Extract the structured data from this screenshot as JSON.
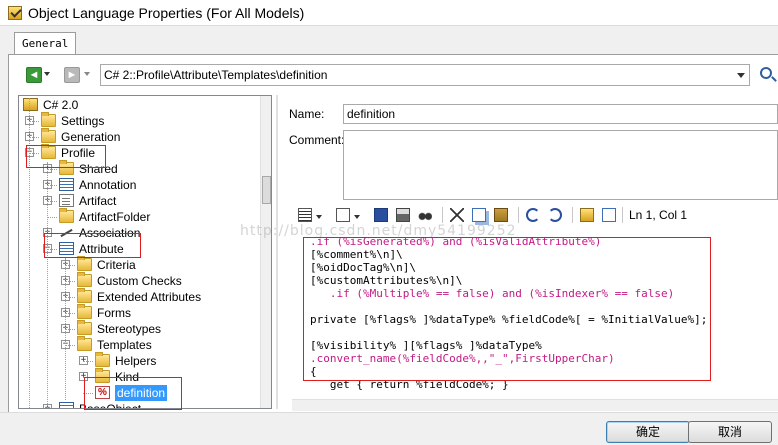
{
  "window": {
    "title": "Object Language Properties (For All Models)"
  },
  "tabs": [
    {
      "label": "General"
    }
  ],
  "navigation": {
    "back_glyph": "◄",
    "forward_glyph": "►",
    "path": "C# 2::Profile\\Attribute\\Templates\\definition",
    "back_icon": "arrow-left-icon",
    "forward_icon": "arrow-right-icon",
    "find_icon": "search-icon"
  },
  "tree": {
    "items": [
      {
        "label": "C# 2.0",
        "icon": "model-icon"
      },
      {
        "label": "Settings",
        "icon": "folder-icon"
      },
      {
        "label": "Generation",
        "icon": "folder-icon"
      },
      {
        "label": "Profile",
        "icon": "folder-open-icon"
      },
      {
        "label": "Shared",
        "icon": "folder-icon"
      },
      {
        "label": "Annotation",
        "icon": "metaclass-icon"
      },
      {
        "label": "Artifact",
        "icon": "document-icon"
      },
      {
        "label": "ArtifactFolder",
        "icon": "folder-icon"
      },
      {
        "label": "Association",
        "icon": "association-icon"
      },
      {
        "label": "Attribute",
        "icon": "metaclass-icon"
      },
      {
        "label": "Criteria",
        "icon": "folder-icon"
      },
      {
        "label": "Custom Checks",
        "icon": "folder-icon"
      },
      {
        "label": "Extended Attributes",
        "icon": "folder-icon"
      },
      {
        "label": "Forms",
        "icon": "folder-icon"
      },
      {
        "label": "Stereotypes",
        "icon": "folder-icon"
      },
      {
        "label": "Templates",
        "icon": "folder-open-icon"
      },
      {
        "label": "Helpers",
        "icon": "folder-icon"
      },
      {
        "label": "Kind",
        "icon": "folder-icon"
      },
      {
        "label": "definition",
        "icon": "template-icon",
        "selected": true
      },
      {
        "label": "BaseObject",
        "icon": "metaclass-icon"
      }
    ],
    "collapsed_glyph": "+",
    "expanded_glyph": "−",
    "template_glyph": "%"
  },
  "form": {
    "name_label": "Name:",
    "name_value": "definition",
    "comment_label": "Comment:",
    "comment_value": ""
  },
  "editor_toolbar": {
    "position": "Ln 1, Col 1",
    "icons": [
      "properties-icon",
      "edit-icon",
      "save-icon",
      "print-icon",
      "find-icon",
      "cut-icon",
      "copy-icon",
      "paste-icon",
      "undo-icon",
      "redo-icon",
      "insert-field-icon",
      "operators-icon"
    ]
  },
  "editor": {
    "lines": [
      {
        "text": ".if (%isGenerated%) and (%isValidAttribute%)",
        "color": "#c21a86"
      },
      {
        "text": "[%comment%\\n]\\",
        "color": "#000000"
      },
      {
        "text": "[%oidDocTag%\\n]\\",
        "color": "#000000"
      },
      {
        "text": "[%customAttributes%\\n]\\",
        "color": "#000000"
      },
      {
        "text": "   .if (%Multiple% == false) and (%isIndexer% == false)",
        "color": "#c21a86"
      },
      {
        "text": "",
        "color": "#000000"
      },
      {
        "text": "private [%flags% ]%dataType% %fieldCode%[ = %InitialValue%];",
        "color": "#000000"
      },
      {
        "text": "",
        "color": "#000000"
      },
      {
        "text": "[%visibility% ][%flags% ]%dataType%",
        "color": "#000000"
      },
      {
        "text": ".convert_name(%fieldCode%,,\"_\",FirstUpperChar)",
        "color": "#c21a86"
      },
      {
        "text": "{",
        "color": "#000000"
      },
      {
        "text": "   get { return %fieldCode%; }",
        "color": "#000000"
      }
    ]
  },
  "watermark": "http://blog.csdn.net/dmy54199252",
  "buttons": {
    "ok": "确定",
    "cancel": "取消"
  },
  "colors": {
    "highlight": "#e01c1c",
    "selection": "#3399ff",
    "keyword": "#c21a86"
  }
}
